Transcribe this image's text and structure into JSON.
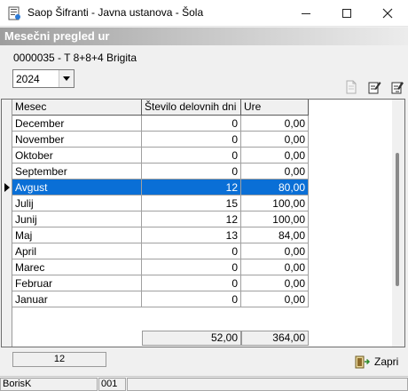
{
  "window": {
    "title": "Saop Šifranti - Javna ustanova - Šola"
  },
  "header": {
    "title": "Mesečni pregled ur"
  },
  "employee": {
    "label": "0000035 - T  8+8+4 Brigita"
  },
  "year_select": {
    "value": "2024"
  },
  "grid": {
    "columns": [
      "Mesec",
      "Število delovnih dni",
      "Ure"
    ],
    "rows": [
      {
        "mesec": "December",
        "dni": "0",
        "ure": "0,00"
      },
      {
        "mesec": "November",
        "dni": "0",
        "ure": "0,00"
      },
      {
        "mesec": "Oktober",
        "dni": "0",
        "ure": "0,00"
      },
      {
        "mesec": "September",
        "dni": "0",
        "ure": "0,00"
      },
      {
        "mesec": "Avgust",
        "dni": "12",
        "ure": "80,00"
      },
      {
        "mesec": "Julij",
        "dni": "15",
        "ure": "100,00"
      },
      {
        "mesec": "Junij",
        "dni": "12",
        "ure": "100,00"
      },
      {
        "mesec": "Maj",
        "dni": "13",
        "ure": "84,00"
      },
      {
        "mesec": "April",
        "dni": "0",
        "ure": "0,00"
      },
      {
        "mesec": "Marec",
        "dni": "0",
        "ure": "0,00"
      },
      {
        "mesec": "Februar",
        "dni": "0",
        "ure": "0,00"
      },
      {
        "mesec": "Januar",
        "dni": "0",
        "ure": "0,00"
      }
    ],
    "selected_index": 4,
    "totals": {
      "dni": "52,00",
      "ure": "364,00"
    }
  },
  "footer": {
    "count": "12",
    "close_label": "Zapri"
  },
  "statusbar": {
    "user": "BorisK",
    "code": "001",
    "rest": ""
  },
  "colors": {
    "selection": "#0a6fd6"
  },
  "icons": {
    "toolbar": [
      "new-document-icon",
      "edit-document-icon",
      "edit-document-alt-icon"
    ],
    "close": "door-exit-icon"
  }
}
